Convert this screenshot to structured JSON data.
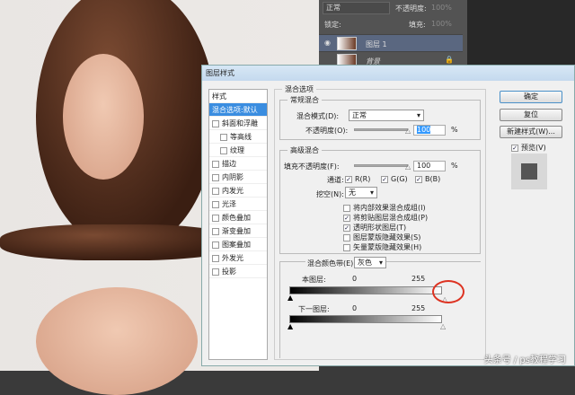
{
  "layers_panel": {
    "blend_mode": "正常",
    "opacity_label": "不透明度:",
    "opacity_value": "100%",
    "lock_label": "锁定:",
    "fill_label": "填充:",
    "fill_value": "100%",
    "layers": [
      {
        "name": "图层 1",
        "selected": true
      },
      {
        "name": "背景",
        "selected": false
      }
    ]
  },
  "dialog": {
    "title": "图层样式",
    "styles_header": "样式",
    "styles": [
      {
        "label": "混合选项:默认",
        "selected": true,
        "checkbox": false,
        "indent": false
      },
      {
        "label": "斜面和浮雕",
        "checkbox": true,
        "indent": false
      },
      {
        "label": "等高线",
        "checkbox": true,
        "indent": true
      },
      {
        "label": "纹理",
        "checkbox": true,
        "indent": true
      },
      {
        "label": "描边",
        "checkbox": true,
        "indent": false
      },
      {
        "label": "内阴影",
        "checkbox": true,
        "indent": false
      },
      {
        "label": "内发光",
        "checkbox": true,
        "indent": false
      },
      {
        "label": "光泽",
        "checkbox": true,
        "indent": false
      },
      {
        "label": "颜色叠加",
        "checkbox": true,
        "indent": false
      },
      {
        "label": "渐变叠加",
        "checkbox": true,
        "indent": false
      },
      {
        "label": "图案叠加",
        "checkbox": true,
        "indent": false
      },
      {
        "label": "外发光",
        "checkbox": true,
        "indent": false
      },
      {
        "label": "投影",
        "checkbox": true,
        "indent": false
      }
    ],
    "blend_options": "混合选项",
    "general": {
      "title": "常规混合",
      "mode_label": "混合模式(D):",
      "mode_value": "正常",
      "opacity_label": "不透明度(O):",
      "opacity_value": "100",
      "percent": "%"
    },
    "advanced": {
      "title": "高级混合",
      "fill_label": "填充不透明度(F):",
      "fill_value": "100",
      "percent": "%",
      "channels_label": "通道:",
      "r": "R(R)",
      "g": "G(G)",
      "b": "B(B)",
      "knockout_label": "挖空(N):",
      "knockout_value": "无",
      "options": [
        {
          "label": "将内部效果混合成组(I)",
          "checked": false
        },
        {
          "label": "将剪贴图层混合成组(P)",
          "checked": true
        },
        {
          "label": "透明形状图层(T)",
          "checked": true
        },
        {
          "label": "图层蒙版隐藏效果(S)",
          "checked": false
        },
        {
          "label": "矢量蒙版隐藏效果(H)",
          "checked": false
        }
      ]
    },
    "blend_if": {
      "label": "混合颜色带(E):",
      "value": "灰色",
      "this_layer": "本图层:",
      "this_min": "0",
      "this_max": "255",
      "under_layer": "下一图层:",
      "under_min": "0",
      "under_max": "255"
    },
    "buttons": {
      "ok": "确定",
      "reset": "复位",
      "new_style": "新建样式(W)...",
      "preview": "预览(V)"
    }
  },
  "watermark": "头条号 / ps教程学习"
}
